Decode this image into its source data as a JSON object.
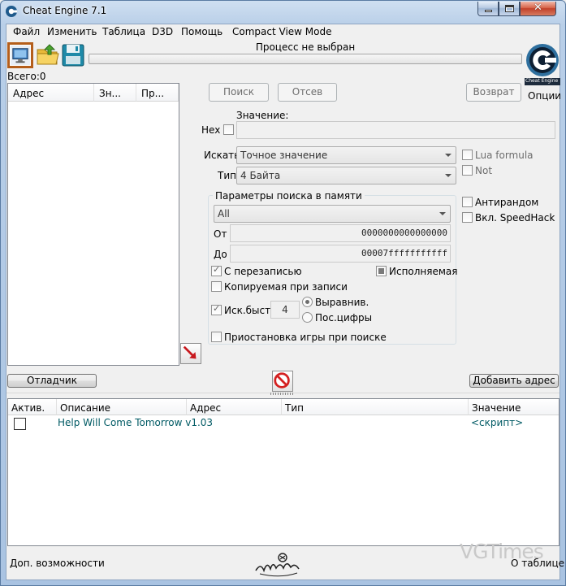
{
  "window": {
    "title": "Cheat Engine 7.1"
  },
  "menu": [
    "Файл",
    "Изменить",
    "Таблица",
    "D3D",
    "Помощь",
    "Compact View Mode"
  ],
  "toolbar": {
    "process_label": "Процесс не выбран",
    "options_label": "Опции",
    "logo_text": "Cheat Engine"
  },
  "found_count": "Всего:0",
  "results_list": {
    "columns": [
      "Адрес",
      "Зн...",
      "Пр..."
    ]
  },
  "scan": {
    "first_scan": "Поиск",
    "next_scan": "Отсев",
    "undo_scan": "Возврат",
    "value_label": "Значение:",
    "hex_label": "Hex",
    "scan_type_label": "Искать",
    "scan_type": "Точное значение",
    "value_type_label": "Тип",
    "value_type": "4 Байта",
    "lua_formula": "Lua formula",
    "not_label": "Not",
    "unrandomizer": "Антирандом",
    "speedhack": "Вкл. SpeedHack"
  },
  "memory": {
    "title": "Параметры поиска в памяти",
    "region": "All",
    "from_label": "От",
    "from_value": "0000000000000000",
    "to_label": "До",
    "to_value": "00007fffffffffff",
    "writable": "С перезаписью",
    "executable": "Исполняемая",
    "copy_on_write": "Копируемая при записи",
    "fast_scan": "Иск.быст.",
    "fast_scan_value": "4",
    "alignment": "Выравнив.",
    "last_digits": "Пос.цифры",
    "pause_game": "Приостановка игры при поиске"
  },
  "buttons": {
    "debugger": "Отладчик",
    "add_address": "Добавить адрес"
  },
  "cheat_table": {
    "columns": [
      "Актив.",
      "Описание",
      "Адрес",
      "Тип",
      "Значение"
    ],
    "rows": [
      {
        "description": "Help Will Come Tomorrow v1.03",
        "value": "<скрипт>"
      }
    ]
  },
  "status": {
    "left": "Доп. возможности",
    "right": "О таблице",
    "watermark": "VGTimes"
  },
  "colors": {
    "process_button": "#b45e1b",
    "script_row_text": "#005a64"
  }
}
